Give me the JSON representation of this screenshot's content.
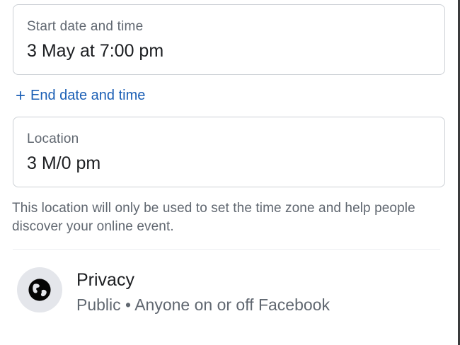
{
  "start": {
    "label": "Start date and time",
    "value": "3 May at 7:00 pm"
  },
  "end_link": {
    "icon": "plus-icon",
    "label": "End date and time",
    "color": "#1b5fb5"
  },
  "location": {
    "label": "Location",
    "value": "3 M/0 pm"
  },
  "help_text": "This location will only be used to set the time zone and help people discover your online event.",
  "privacy": {
    "icon": "globe-icon",
    "title": "Privacy",
    "subtitle": "Public • Anyone on or off Facebook"
  }
}
